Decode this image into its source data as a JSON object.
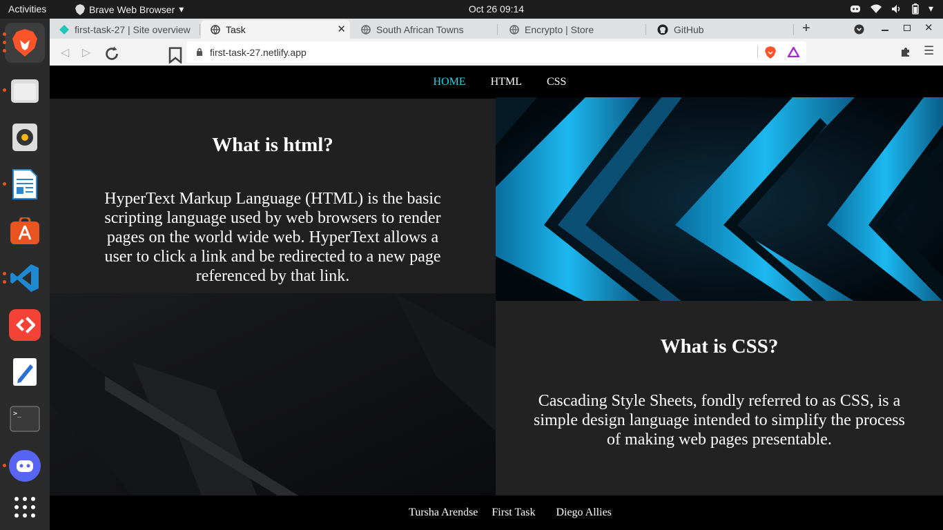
{
  "topbar": {
    "activities": "Activities",
    "app_name": "Brave Web Browser",
    "clock": "Oct 26  09:14"
  },
  "browser": {
    "tabs": [
      {
        "label": "first-task-27 | Site overview",
        "icon": "netlify-icon"
      },
      {
        "label": "Task",
        "icon": "globe-icon"
      },
      {
        "label": "South African Towns",
        "icon": "globe-icon"
      },
      {
        "label": "Encrypto | Store",
        "icon": "globe-icon"
      },
      {
        "label": "GitHub",
        "icon": "github-icon"
      }
    ],
    "url": "first-task-27.netlify.app"
  },
  "site": {
    "nav": {
      "home": "HOME",
      "html": "HTML",
      "css": "CSS"
    },
    "html_section": {
      "title": "What is html?",
      "body": "HyperText Markup Language (HTML) is the basic scripting language used by web browsers to render pages on the world wide web. HyperText allows a user to click a link and be redirected to a new page referenced by that link."
    },
    "css_section": {
      "title": "What is CSS?",
      "body": "Cascading Style Sheets, fondly referred to as CSS, is a simple design language intended to simplify the process of making web pages presentable."
    },
    "footer": {
      "author": "Tursha Arendse",
      "project": "First Task",
      "partner": "Diego Allies"
    }
  },
  "colors": {
    "accent": "#27d3e4",
    "banner_blue": "#18a8e6"
  }
}
